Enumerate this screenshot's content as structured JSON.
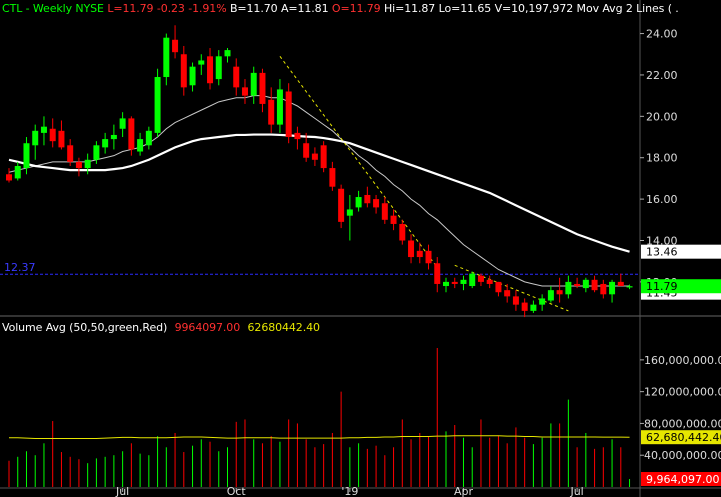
{
  "header": {
    "symbol": "CTL",
    "sep": " - ",
    "period": "Weekly",
    "exchange": "NYSE",
    "last": "L=11.79",
    "change": "-0.23",
    "change_pct": "-1.91%",
    "bid": "B=11.70",
    "ask": "A=11.81",
    "open": "O=11.79",
    "high": "Hi=11.87",
    "low": "Lo=11.65",
    "volume": "V=10,197,972",
    "study": "Mov Avg 2 Lines",
    "study_suffix": "( ."
  },
  "volume_header": {
    "label": "Volume Avg (50,50,green,Red)",
    "value1": "9964097.00",
    "value2": "62680442.40"
  },
  "colors": {
    "background": "#000000",
    "up": "#00ff00",
    "down": "#ff0000",
    "ma_short": "#c8c8c8",
    "ma_long": "#ffffff",
    "trendline": "#e6e600",
    "volume_avg": "#e6e600",
    "ref_line": "#2a2aff",
    "grid": "#3c3c3c"
  },
  "chart_data": [
    {
      "type": "candlestick",
      "title": "CTL - Weekly NYSE",
      "y_ticks": [
        24,
        22,
        20,
        18,
        16,
        14,
        12
      ],
      "y_tick_labels": [
        "24.00",
        "22.00",
        "20.00",
        "18.00",
        "16.00",
        "14.00",
        "12.00"
      ],
      "ylim": [
        10.4,
        24.8
      ],
      "x_labels": [
        {
          "index": 13,
          "label": "Jul"
        },
        {
          "index": 26,
          "label": "Oct"
        },
        {
          "index": 39,
          "label": "'19"
        },
        {
          "index": 52,
          "label": "Apr"
        },
        {
          "index": 65,
          "label": "Jul"
        }
      ],
      "ref_line": {
        "value": 12.37,
        "label": "12.37"
      },
      "last_price_tag": "11.79",
      "ma_long_tag": "13.46",
      "hidden_tag": "11.45",
      "candles": [
        {
          "o": 17.2,
          "h": 17.5,
          "l": 16.8,
          "c": 16.9
        },
        {
          "o": 17.0,
          "h": 17.8,
          "l": 16.9,
          "c": 17.6
        },
        {
          "o": 17.5,
          "h": 19.0,
          "l": 17.2,
          "c": 18.7
        },
        {
          "o": 18.6,
          "h": 19.6,
          "l": 17.9,
          "c": 19.3
        },
        {
          "o": 19.2,
          "h": 20.0,
          "l": 18.6,
          "c": 19.5
        },
        {
          "o": 19.4,
          "h": 19.9,
          "l": 18.5,
          "c": 18.8
        },
        {
          "o": 19.3,
          "h": 19.8,
          "l": 18.4,
          "c": 18.5
        },
        {
          "o": 18.6,
          "h": 18.9,
          "l": 17.6,
          "c": 17.8
        },
        {
          "o": 17.8,
          "h": 18.0,
          "l": 17.1,
          "c": 17.5
        },
        {
          "o": 17.5,
          "h": 18.2,
          "l": 17.2,
          "c": 17.9
        },
        {
          "o": 17.9,
          "h": 18.8,
          "l": 17.7,
          "c": 18.6
        },
        {
          "o": 18.5,
          "h": 19.2,
          "l": 18.2,
          "c": 18.9
        },
        {
          "o": 18.9,
          "h": 19.6,
          "l": 18.4,
          "c": 19.1
        },
        {
          "o": 19.4,
          "h": 20.2,
          "l": 19.0,
          "c": 19.9
        },
        {
          "o": 19.9,
          "h": 20.0,
          "l": 18.1,
          "c": 18.4
        },
        {
          "o": 18.3,
          "h": 19.2,
          "l": 18.1,
          "c": 18.9
        },
        {
          "o": 18.6,
          "h": 19.5,
          "l": 18.4,
          "c": 19.3
        },
        {
          "o": 19.2,
          "h": 22.3,
          "l": 19.0,
          "c": 21.9
        },
        {
          "o": 21.9,
          "h": 24.0,
          "l": 21.5,
          "c": 23.8
        },
        {
          "o": 23.7,
          "h": 24.4,
          "l": 22.8,
          "c": 23.1
        },
        {
          "o": 23.0,
          "h": 23.4,
          "l": 21.0,
          "c": 21.4
        },
        {
          "o": 21.5,
          "h": 22.6,
          "l": 21.2,
          "c": 22.4
        },
        {
          "o": 22.5,
          "h": 23.0,
          "l": 22.0,
          "c": 22.7
        },
        {
          "o": 22.9,
          "h": 23.3,
          "l": 21.3,
          "c": 21.6
        },
        {
          "o": 21.8,
          "h": 23.2,
          "l": 21.5,
          "c": 22.9
        },
        {
          "o": 22.9,
          "h": 23.3,
          "l": 22.6,
          "c": 23.2
        },
        {
          "o": 22.4,
          "h": 22.8,
          "l": 21.0,
          "c": 21.4
        },
        {
          "o": 21.4,
          "h": 21.8,
          "l": 20.6,
          "c": 21.0
        },
        {
          "o": 21.0,
          "h": 22.4,
          "l": 20.6,
          "c": 22.1
        },
        {
          "o": 22.1,
          "h": 22.3,
          "l": 20.2,
          "c": 20.6
        },
        {
          "o": 20.8,
          "h": 21.4,
          "l": 19.2,
          "c": 19.6
        },
        {
          "o": 19.6,
          "h": 21.8,
          "l": 19.2,
          "c": 21.3
        },
        {
          "o": 21.2,
          "h": 21.6,
          "l": 18.7,
          "c": 19.0
        },
        {
          "o": 19.2,
          "h": 19.5,
          "l": 18.4,
          "c": 18.9
        },
        {
          "o": 18.7,
          "h": 19.2,
          "l": 17.8,
          "c": 18.0
        },
        {
          "o": 18.2,
          "h": 18.5,
          "l": 17.6,
          "c": 17.9
        },
        {
          "o": 18.6,
          "h": 18.8,
          "l": 17.3,
          "c": 17.5
        },
        {
          "o": 17.5,
          "h": 17.8,
          "l": 16.4,
          "c": 16.6
        },
        {
          "o": 16.5,
          "h": 16.7,
          "l": 14.6,
          "c": 14.9
        },
        {
          "o": 15.2,
          "h": 16.2,
          "l": 14.0,
          "c": 15.5
        },
        {
          "o": 15.6,
          "h": 16.4,
          "l": 15.4,
          "c": 16.1
        },
        {
          "o": 16.2,
          "h": 16.6,
          "l": 15.6,
          "c": 15.8
        },
        {
          "o": 16.0,
          "h": 16.2,
          "l": 15.3,
          "c": 15.6
        },
        {
          "o": 15.8,
          "h": 16.1,
          "l": 14.8,
          "c": 15.0
        },
        {
          "o": 15.2,
          "h": 15.5,
          "l": 14.5,
          "c": 14.8
        },
        {
          "o": 14.8,
          "h": 15.0,
          "l": 13.8,
          "c": 14.0
        },
        {
          "o": 14.0,
          "h": 14.3,
          "l": 12.9,
          "c": 13.2
        },
        {
          "o": 13.5,
          "h": 13.9,
          "l": 12.9,
          "c": 13.2
        },
        {
          "o": 13.5,
          "h": 13.8,
          "l": 12.6,
          "c": 12.9
        },
        {
          "o": 12.9,
          "h": 13.2,
          "l": 11.5,
          "c": 11.9
        },
        {
          "o": 11.8,
          "h": 12.2,
          "l": 11.5,
          "c": 12.0
        },
        {
          "o": 12.0,
          "h": 12.2,
          "l": 11.7,
          "c": 11.9
        },
        {
          "o": 11.9,
          "h": 12.3,
          "l": 11.6,
          "c": 12.1
        },
        {
          "o": 11.8,
          "h": 12.5,
          "l": 11.7,
          "c": 12.4
        },
        {
          "o": 12.3,
          "h": 12.4,
          "l": 11.8,
          "c": 12.0
        },
        {
          "o": 12.1,
          "h": 12.3,
          "l": 11.7,
          "c": 11.9
        },
        {
          "o": 12.0,
          "h": 12.0,
          "l": 11.3,
          "c": 11.5
        },
        {
          "o": 11.6,
          "h": 11.9,
          "l": 11.0,
          "c": 11.3
        },
        {
          "o": 11.3,
          "h": 11.6,
          "l": 10.6,
          "c": 10.9
        },
        {
          "o": 11.0,
          "h": 11.2,
          "l": 10.3,
          "c": 10.6
        },
        {
          "o": 10.6,
          "h": 11.1,
          "l": 10.5,
          "c": 10.9
        },
        {
          "o": 10.9,
          "h": 11.4,
          "l": 10.6,
          "c": 11.2
        },
        {
          "o": 11.1,
          "h": 11.8,
          "l": 11.0,
          "c": 11.6
        },
        {
          "o": 11.6,
          "h": 12.2,
          "l": 11.0,
          "c": 11.4
        },
        {
          "o": 11.4,
          "h": 12.3,
          "l": 11.2,
          "c": 12.0
        },
        {
          "o": 11.9,
          "h": 12.2,
          "l": 11.7,
          "c": 11.8
        },
        {
          "o": 11.7,
          "h": 12.2,
          "l": 11.5,
          "c": 12.1
        },
        {
          "o": 12.1,
          "h": 12.3,
          "l": 11.5,
          "c": 11.6
        },
        {
          "o": 11.9,
          "h": 12.1,
          "l": 11.2,
          "c": 11.4
        },
        {
          "o": 11.4,
          "h": 12.1,
          "l": 11.0,
          "c": 12.0
        },
        {
          "o": 12.0,
          "h": 12.4,
          "l": 11.8,
          "c": 11.8
        },
        {
          "o": 11.79,
          "h": 11.87,
          "l": 11.65,
          "c": 11.79
        }
      ],
      "ma_short": [
        17.3,
        17.4,
        17.5,
        17.6,
        17.7,
        17.8,
        17.8,
        17.8,
        17.8,
        17.8,
        17.9,
        18.0,
        18.1,
        18.3,
        18.4,
        18.5,
        18.7,
        19.0,
        19.4,
        19.7,
        19.9,
        20.1,
        20.3,
        20.5,
        20.7,
        20.8,
        20.9,
        20.9,
        21.0,
        21.0,
        20.9,
        20.9,
        20.7,
        20.5,
        20.2,
        19.9,
        19.6,
        19.3,
        18.9,
        18.5,
        18.1,
        17.8,
        17.4,
        17.1,
        16.7,
        16.4,
        16.0,
        15.7,
        15.3,
        15.0,
        14.6,
        14.2,
        13.8,
        13.5,
        13.2,
        12.9,
        12.6,
        12.4,
        12.2,
        12.0,
        11.9,
        11.8,
        11.8,
        11.8,
        11.8,
        11.8,
        11.8,
        11.8,
        11.8,
        11.8,
        11.8,
        11.8
      ],
      "ma_long": [
        17.9,
        17.8,
        17.7,
        17.6,
        17.55,
        17.5,
        17.45,
        17.4,
        17.4,
        17.4,
        17.4,
        17.4,
        17.45,
        17.5,
        17.6,
        17.75,
        17.9,
        18.1,
        18.3,
        18.5,
        18.65,
        18.8,
        18.9,
        18.95,
        19.0,
        19.05,
        19.1,
        19.1,
        19.12,
        19.12,
        19.12,
        19.1,
        19.08,
        19.05,
        19.02,
        19.0,
        18.95,
        18.88,
        18.8,
        18.7,
        18.55,
        18.4,
        18.25,
        18.1,
        17.95,
        17.8,
        17.65,
        17.5,
        17.35,
        17.2,
        17.05,
        16.9,
        16.75,
        16.6,
        16.45,
        16.3,
        16.1,
        15.9,
        15.7,
        15.5,
        15.3,
        15.1,
        14.9,
        14.7,
        14.5,
        14.3,
        14.15,
        14.0,
        13.85,
        13.7,
        13.58,
        13.46
      ],
      "trendlines": [
        {
          "from": {
            "index": 31,
            "value": 22.9
          },
          "to": {
            "index": 49,
            "value": 12.7
          }
        },
        {
          "from": {
            "index": 51,
            "value": 12.8
          },
          "to": {
            "index": 64,
            "value": 10.6
          }
        }
      ]
    },
    {
      "type": "bar",
      "title": "Volume Avg (50,50,green,Red)",
      "y_tick_labels": [
        "160,000,000.00",
        "120,000,000.00",
        "80,000,000.00",
        "40,000,000.00"
      ],
      "y_ticks": [
        160000000,
        120000000,
        80000000,
        40000000
      ],
      "ylim": [
        0,
        185000000
      ],
      "avg_tag": "62,680,442.40",
      "last_volume_tag": "9,964,097.00",
      "volumes": [
        33,
        38,
        45,
        40,
        55,
        83,
        44,
        38,
        35,
        30,
        36,
        38,
        40,
        45,
        55,
        42,
        40,
        64,
        50,
        68,
        44,
        52,
        60,
        57,
        45,
        50,
        82,
        85,
        60,
        55,
        64,
        57,
        85,
        80,
        60,
        50,
        54,
        68,
        120,
        50,
        55,
        48,
        52,
        40,
        50,
        85,
        60,
        68,
        64,
        175,
        70,
        78,
        62,
        50,
        85,
        62,
        65,
        55,
        75,
        62,
        54,
        62,
        80,
        80,
        110,
        50,
        68,
        48,
        50,
        60,
        50,
        10
      ],
      "volume_avg": [
        62,
        62,
        61.5,
        61,
        61,
        61,
        61,
        61,
        61,
        61,
        61,
        61.5,
        62,
        62.5,
        62.5,
        62,
        62,
        62,
        62,
        62.5,
        63,
        63,
        63,
        62.5,
        62,
        61.5,
        61.5,
        62,
        62,
        62,
        62,
        61.5,
        61.5,
        61.5,
        61.5,
        61.5,
        61.5,
        61.5,
        61.5,
        62,
        62,
        62.5,
        62.5,
        63,
        63,
        63.5,
        63.5,
        63.5,
        63.5,
        64,
        64,
        64.5,
        64.5,
        64.5,
        64.5,
        64.5,
        64.5,
        64,
        64,
        63.5,
        63.5,
        63,
        63,
        63,
        63,
        63,
        63,
        63,
        62.8,
        62.7,
        62.7,
        62.68
      ]
    }
  ]
}
